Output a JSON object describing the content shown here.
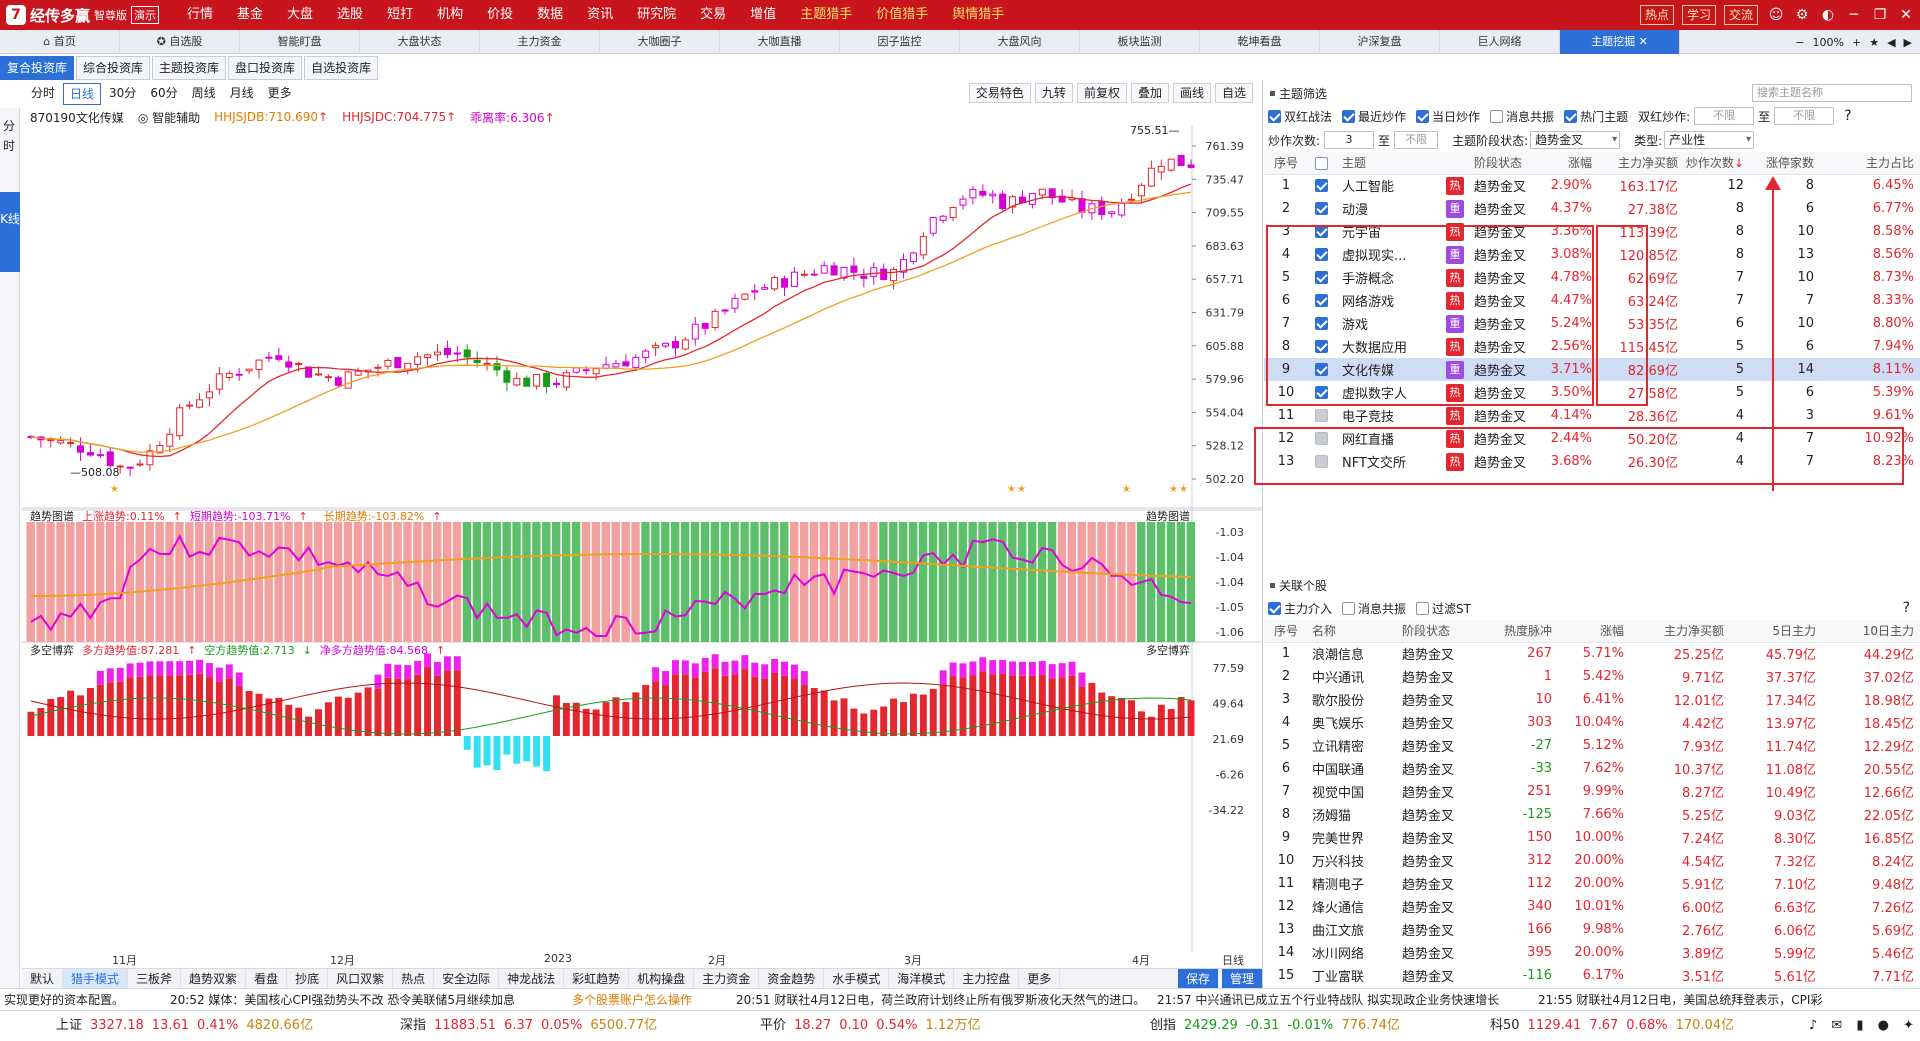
{
  "app": {
    "logo_text": "经传多赢",
    "logo_badge": "7",
    "edition": "智尊版",
    "demo": "演示",
    "menu": [
      "行情",
      "基金",
      "大盘",
      "选股",
      "短打",
      "机构",
      "价投",
      "数据",
      "资讯",
      "研究院",
      "交易",
      "增值",
      "主题猎手",
      "价值猎手",
      "舆情猎手"
    ],
    "highlight_menu": [
      "主题猎手",
      "价值猎手",
      "舆情猎手"
    ],
    "right_buttons": [
      "热点",
      "学习",
      "交流"
    ]
  },
  "tabs": [
    "首页",
    "自选股",
    "智能盯盘",
    "大盘状态",
    "主力资金",
    "大咖圈子",
    "大咖直播",
    "因子监控",
    "大盘风向",
    "板块监测",
    "乾坤看盘",
    "沪深复盘",
    "巨人网络",
    "主题挖掘"
  ],
  "active_tab": "主题挖掘",
  "zoom": "100%",
  "subtabs": [
    "复合投资库",
    "综合投资库",
    "主题投资库",
    "盘口投资库",
    "自选投资库"
  ],
  "active_subtab": "复合投资库",
  "left_strip": {
    "top": "分时",
    "kline": "K线"
  },
  "periods": [
    "分时",
    "日线",
    "30分",
    "60分",
    "周线",
    "月线",
    "更多"
  ],
  "active_period": "日线",
  "chart_tools": [
    "交易特色",
    "九转",
    "前复权",
    "叠加",
    "画线",
    "自选"
  ],
  "stock": {
    "code_name": "870190文化传媒",
    "assist": "智能辅助",
    "hhjsjdb": "HHJSJDB:710.690",
    "hhjsjdc": "HHJSJDC:704.775",
    "deviation": "乖离率:6.306"
  },
  "main_yaxis": [
    "761.39",
    "735.47",
    "709.55",
    "683.63",
    "657.71",
    "631.79",
    "605.88",
    "579.96",
    "554.04",
    "528.12",
    "502.20"
  ],
  "price_high": "755.51",
  "price_low": "508.08",
  "trend_pane": {
    "title": "趋势图谱",
    "up": "上涨趋势:0.11%",
    "short": "短期趋势:-103.71%",
    "long": "长期趋势:-103.82%",
    "yaxis": [
      "-1.03",
      "-1.04",
      "-1.04",
      "-1.05",
      "-1.06"
    ]
  },
  "ls_pane": {
    "title": "多空博弈",
    "long": "多方趋势值:87.281",
    "short": "空方趋势值:2.713",
    "net": "净多方趋势值:84.568",
    "yaxis": [
      "77.59",
      "49.64",
      "21.69",
      "-6.26",
      "-34.22"
    ]
  },
  "xaxis_labels": [
    "11月",
    "12月",
    "2023",
    "2月",
    "3月",
    "4月",
    "日线"
  ],
  "bottom_tools": [
    "默认",
    "猎手模式",
    "三板斧",
    "趋势双紫",
    "看盘",
    "抄底",
    "风口双紫",
    "热点",
    "安全边际",
    "神龙战法",
    "彩虹趋势",
    "机构操盘",
    "主力资金",
    "资金趋势",
    "水手模式",
    "海洋模式",
    "主力控盘",
    "更多"
  ],
  "active_bottom_tool": "猎手模式",
  "bottom_actions": [
    "保存",
    "管理"
  ],
  "theme_panel": {
    "title": "主题筛选",
    "search_placeholder": "搜索主题名称",
    "filters": [
      {
        "label": "双红战法",
        "on": true
      },
      {
        "label": "最近炒作",
        "on": true
      },
      {
        "label": "当日炒作",
        "on": true
      },
      {
        "label": "消息共振",
        "on": false
      },
      {
        "label": "热门主题",
        "on": true
      }
    ],
    "double_red_label": "双红炒作:",
    "unlimited": "不限",
    "to": "至",
    "count_label": "炒作次数:",
    "count_value": "3",
    "stage_label": "主题阶段状态:",
    "stage_value": "趋势金叉",
    "type_label": "类型:",
    "type_value": "产业性",
    "columns": [
      "序号",
      "主题",
      "阶段状态",
      "涨幅",
      "主力净买额",
      "炒作次数",
      "涨停家数",
      "主力占比"
    ],
    "rows": [
      {
        "n": "1",
        "name": "人工智能",
        "tag": "热",
        "stage": "趋势金叉",
        "chg": "2.90%",
        "net": "163.17亿",
        "times": "12",
        "limit": "8",
        "ratio": "6.45%",
        "checked": true
      },
      {
        "n": "2",
        "name": "动漫",
        "tag": "重",
        "stage": "趋势金叉",
        "chg": "4.37%",
        "net": "27.38亿",
        "times": "8",
        "limit": "6",
        "ratio": "6.77%",
        "checked": true
      },
      {
        "n": "3",
        "name": "元宇宙",
        "tag": "热",
        "stage": "趋势金叉",
        "chg": "3.36%",
        "net": "113.39亿",
        "times": "8",
        "limit": "10",
        "ratio": "8.58%",
        "checked": true
      },
      {
        "n": "4",
        "name": "虚拟现实...",
        "tag": "重",
        "stage": "趋势金叉",
        "chg": "3.08%",
        "net": "120.85亿",
        "times": "8",
        "limit": "13",
        "ratio": "8.56%",
        "checked": true
      },
      {
        "n": "5",
        "name": "手游概念",
        "tag": "热",
        "stage": "趋势金叉",
        "chg": "4.78%",
        "net": "62.69亿",
        "times": "7",
        "limit": "10",
        "ratio": "8.73%",
        "checked": true
      },
      {
        "n": "6",
        "name": "网络游戏",
        "tag": "热",
        "stage": "趋势金叉",
        "chg": "4.47%",
        "net": "63.24亿",
        "times": "7",
        "limit": "7",
        "ratio": "8.33%",
        "checked": true
      },
      {
        "n": "7",
        "name": "游戏",
        "tag": "重",
        "stage": "趋势金叉",
        "chg": "5.24%",
        "net": "53.35亿",
        "times": "6",
        "limit": "10",
        "ratio": "8.80%",
        "checked": true
      },
      {
        "n": "8",
        "name": "大数据应用",
        "tag": "热",
        "stage": "趋势金叉",
        "chg": "2.56%",
        "net": "115.45亿",
        "times": "5",
        "limit": "6",
        "ratio": "7.94%",
        "checked": true
      },
      {
        "n": "9",
        "name": "文化传媒",
        "tag": "重",
        "stage": "趋势金叉",
        "chg": "3.71%",
        "net": "82.69亿",
        "times": "5",
        "limit": "14",
        "ratio": "8.11%",
        "checked": true
      },
      {
        "n": "10",
        "name": "虚拟数字人",
        "tag": "热",
        "stage": "趋势金叉",
        "chg": "3.50%",
        "net": "27.58亿",
        "times": "5",
        "limit": "6",
        "ratio": "5.39%",
        "checked": true
      },
      {
        "n": "11",
        "name": "电子竞技",
        "tag": "热",
        "stage": "趋势金叉",
        "chg": "4.14%",
        "net": "28.36亿",
        "times": "4",
        "limit": "3",
        "ratio": "9.61%",
        "checked": false
      },
      {
        "n": "12",
        "name": "网红直播",
        "tag": "热",
        "stage": "趋势金叉",
        "chg": "2.44%",
        "net": "50.20亿",
        "times": "4",
        "limit": "7",
        "ratio": "10.92%",
        "checked": false
      },
      {
        "n": "13",
        "name": "NFT文交所",
        "tag": "热",
        "stage": "趋势金叉",
        "chg": "3.68%",
        "net": "26.30亿",
        "times": "4",
        "limit": "7",
        "ratio": "8.23%",
        "checked": false
      }
    ]
  },
  "stock_panel": {
    "title": "关联个股",
    "filters": [
      {
        "label": "主力介入",
        "on": true
      },
      {
        "label": "消息共振",
        "on": false
      },
      {
        "label": "过滤ST",
        "on": false
      }
    ],
    "columns": [
      "序号",
      "名称",
      "阶段状态",
      "热度脉冲",
      "涨幅",
      "主力净买额",
      "5日主力",
      "10日主力"
    ],
    "rows": [
      [
        "1",
        "浪潮信息",
        "趋势金叉",
        "267",
        "5.71%",
        "25.25亿",
        "45.79亿",
        "44.29亿"
      ],
      [
        "2",
        "中兴通讯",
        "趋势金叉",
        "1",
        "5.42%",
        "9.71亿",
        "37.37亿",
        "37.02亿"
      ],
      [
        "3",
        "歌尔股份",
        "趋势金叉",
        "10",
        "6.41%",
        "12.01亿",
        "17.34亿",
        "18.98亿"
      ],
      [
        "4",
        "奥飞娱乐",
        "趋势金叉",
        "303",
        "10.04%",
        "4.42亿",
        "13.97亿",
        "18.45亿"
      ],
      [
        "5",
        "立讯精密",
        "趋势金叉",
        "-27",
        "5.12%",
        "7.93亿",
        "11.74亿",
        "12.29亿"
      ],
      [
        "6",
        "中国联通",
        "趋势金叉",
        "-33",
        "7.62%",
        "10.37亿",
        "11.08亿",
        "20.55亿"
      ],
      [
        "7",
        "视觉中国",
        "趋势金叉",
        "251",
        "9.99%",
        "8.27亿",
        "10.49亿",
        "12.66亿"
      ],
      [
        "8",
        "汤姆猫",
        "趋势金叉",
        "-125",
        "7.66%",
        "5.25亿",
        "9.03亿",
        "22.05亿"
      ],
      [
        "9",
        "完美世界",
        "趋势金叉",
        "150",
        "10.00%",
        "7.24亿",
        "8.30亿",
        "16.85亿"
      ],
      [
        "10",
        "万兴科技",
        "趋势金叉",
        "312",
        "20.00%",
        "4.54亿",
        "7.32亿",
        "8.24亿"
      ],
      [
        "11",
        "精测电子",
        "趋势金叉",
        "112",
        "20.00%",
        "5.91亿",
        "7.10亿",
        "9.48亿"
      ],
      [
        "12",
        "烽火通信",
        "趋势金叉",
        "340",
        "10.01%",
        "6.00亿",
        "6.63亿",
        "7.26亿"
      ],
      [
        "13",
        "曲江文旅",
        "趋势金叉",
        "166",
        "9.98%",
        "2.76亿",
        "6.06亿",
        "5.69亿"
      ],
      [
        "14",
        "冰川网络",
        "趋势金叉",
        "395",
        "20.00%",
        "3.89亿",
        "5.99亿",
        "5.46亿"
      ],
      [
        "15",
        "丁业富联",
        "趋势金叉",
        "-116",
        "6.17%",
        "3.51亿",
        "5.61亿",
        "7.71亿"
      ]
    ]
  },
  "ticker": [
    "实现更好的资本配置。",
    "20:52 媒体：美国核心CPI强劲势头不改 恐令美联储5月继续加息",
    "多个股票账户怎么操作",
    "20:51 财联社4月12日电，荷兰政府计划终止所有俄罗斯液化天然气的进口。",
    "21:57 中兴通讯已成立五个行业特战队 拟实现政企业务快速增长",
    "21:55 财联社4月12日电，美国总统拜登表示，CPI彩"
  ],
  "indices": [
    {
      "name": "上证",
      "value": "3327.18",
      "chg": "13.61",
      "pct": "0.41%",
      "amt": "4820.66亿"
    },
    {
      "name": "深指",
      "value": "11883.51",
      "chg": "6.37",
      "pct": "0.05%",
      "amt": "6500.77亿"
    },
    {
      "name": "平价",
      "value": "18.27",
      "chg": "0.10",
      "pct": "0.54%",
      "amt": "1.12万亿"
    },
    {
      "name": "创指",
      "value": "2429.29",
      "chg": "-0.31",
      "pct": "-0.01%",
      "amt": "776.74亿"
    },
    {
      "name": "科50",
      "value": "1129.41",
      "chg": "7.67",
      "pct": "0.68%",
      "amt": "170.04亿"
    }
  ],
  "colors": {
    "up": "#e4262f",
    "down": "#1a9b1a",
    "brand": "#c8141c",
    "accent": "#2c6fd6",
    "ma_short": "#e4262f",
    "ma_long": "#f0a020"
  }
}
